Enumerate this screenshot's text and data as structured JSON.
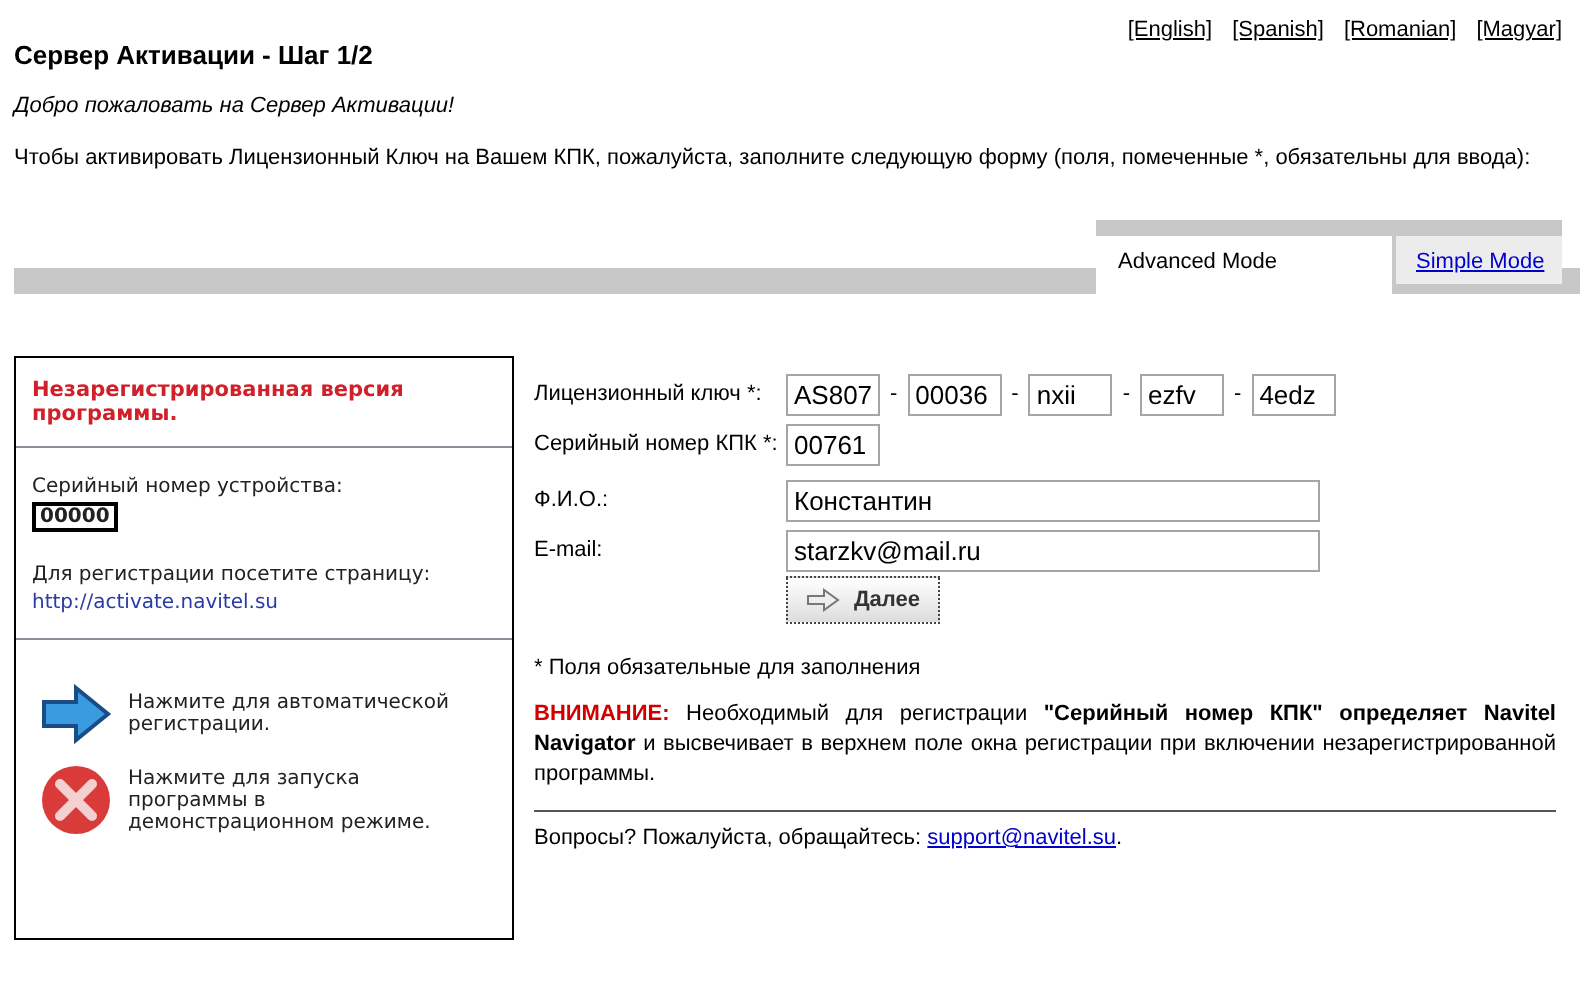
{
  "languages": [
    "[English]",
    "[Spanish]",
    "[Romanian]",
    "[Magyar]"
  ],
  "title": "Сервер Активации - Шаг 1/2",
  "welcome": "Добро пожаловать на Сервер Активации!",
  "intro": "Чтобы активировать Лицензионный Ключ на Вашем КПК, пожалуйста, заполните следующую форму (поля, помеченные *, обязательны для ввода):",
  "tabs": [
    {
      "label": "Advanced Mode",
      "selected": true
    },
    {
      "label": "Simple Mode",
      "selected": false
    }
  ],
  "device_screen": {
    "heading": "Незарегистрированная версия программы.",
    "serial_label": "Серийный номер устройства:",
    "serial": "00000",
    "visit_label": "Для регистрации посетите страницу:",
    "url": "http://activate.navitel.su",
    "actions": [
      {
        "kind": "arrow",
        "text": "Нажмите для автоматической регистрации."
      },
      {
        "kind": "cancel",
        "text": "Нажмите для запуска программы в демонстрационном режиме."
      }
    ]
  },
  "form": {
    "license_label": "Лицензионный ключ *:",
    "license_parts": [
      "AS807",
      "00036",
      "nxii",
      "ezfv",
      "4edz"
    ],
    "separator": "-",
    "serial_label": "Серийный номер КПК *:",
    "serial": "00761",
    "name_label": "Ф.И.О.:",
    "name": "Константин",
    "email_label": "E-mail:",
    "email": "starzkv@mail.ru",
    "submit": "Далее"
  },
  "required_note": "* Поля обязательные для заполнения",
  "warning": {
    "label": "ВНИМАНИЕ:",
    "text": "Необходимый для регистрации **\"Серийный номер КПК\" определяет Navitel Navigator** и высвечивает в верхнем поле окна регистрации при включении незарегистрированной программы."
  },
  "contact": {
    "text": "Вопросы? Пожалуйста, обращайтесь:",
    "link": "support@navitel.su",
    "end": "."
  }
}
